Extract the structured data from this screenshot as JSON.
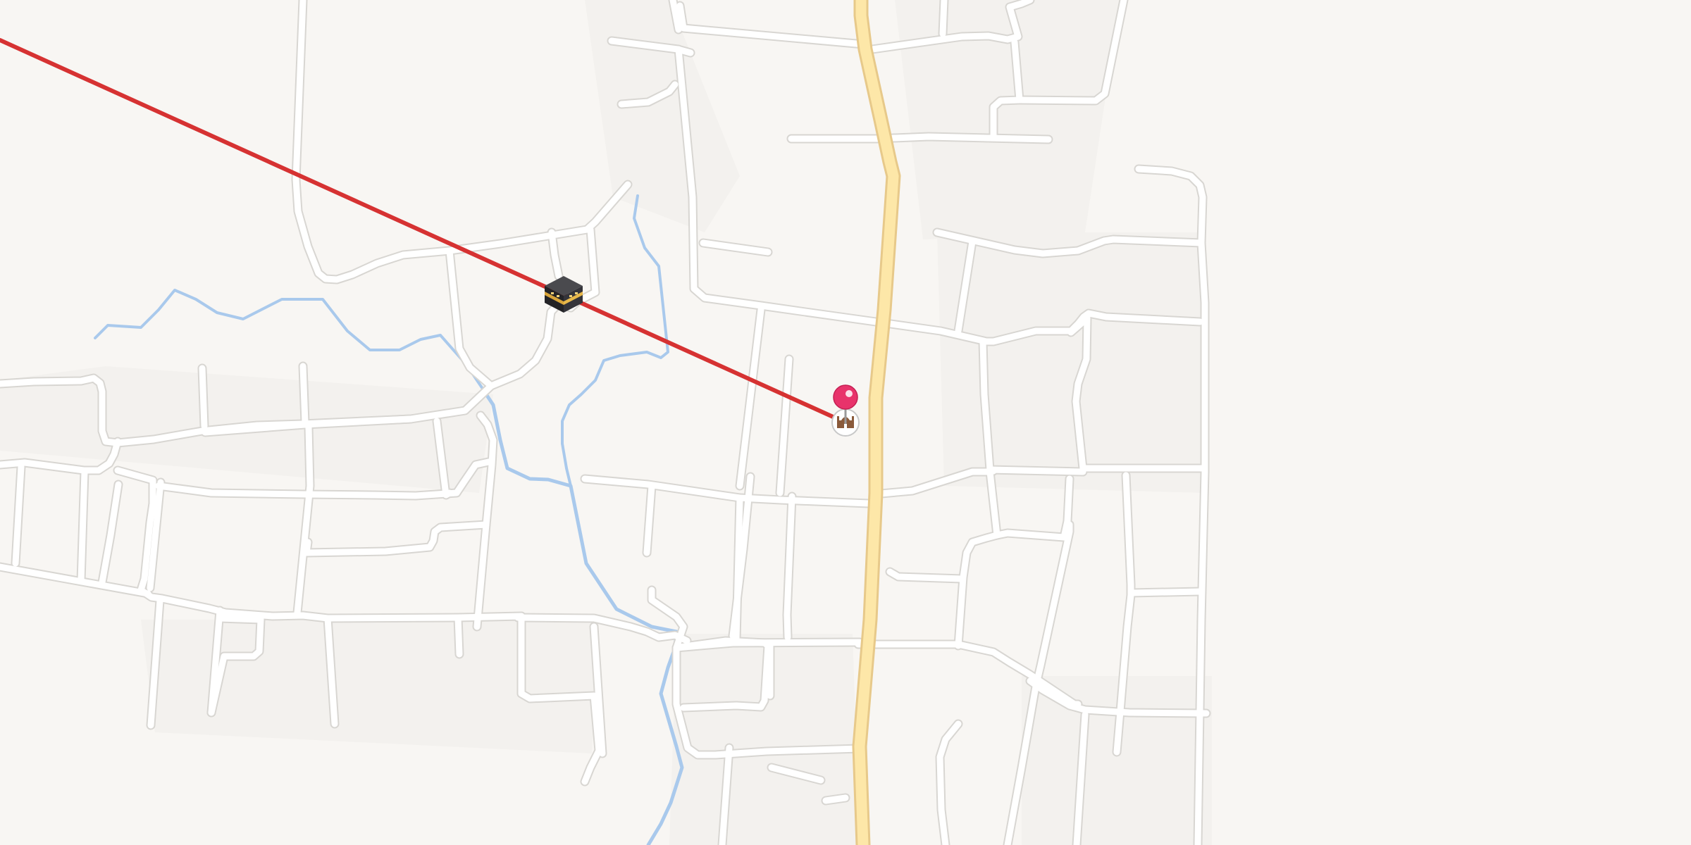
{
  "map": {
    "background_color": "#f8f6f3",
    "road_color": "#ffffff",
    "main_road_color": "#fde7a8",
    "water_color": "#a9c9ec",
    "qibla_line_color": "#d63232",
    "pin_color": "#e8336b"
  },
  "markers": {
    "kaaba": {
      "icon": "kaaba-icon"
    },
    "location_pin": {
      "icon": "location-pin-icon"
    },
    "mosque": {
      "icon": "mosque-icon"
    }
  },
  "qibla_line": {
    "icon": "qibla-direction-line"
  }
}
